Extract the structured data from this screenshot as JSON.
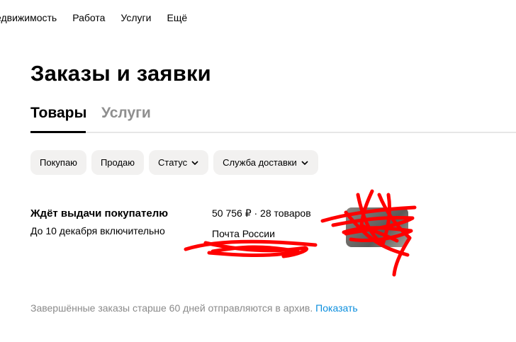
{
  "topnav": {
    "items": [
      "едвижимость",
      "Работа",
      "Услуги",
      "Ещё"
    ]
  },
  "page": {
    "title": "Заказы и заявки"
  },
  "tabs": [
    {
      "label": "Товары",
      "active": true
    },
    {
      "label": "Услуги",
      "active": false
    }
  ],
  "filters": {
    "buying": "Покупаю",
    "selling": "Продаю",
    "status": "Статус",
    "delivery": "Служба доставки"
  },
  "order": {
    "status": "Ждёт выдачи покупателю",
    "due": "До 10 декабря включительно",
    "summary": "50 756 ₽ · 28 товаров",
    "carrier": "Почта России"
  },
  "footer": {
    "note": "Завершённые заказы старше 60 дней отправляются в архив.",
    "link": "Показать"
  },
  "colors": {
    "accent": "#0a8ede",
    "chip": "#f2f1f0",
    "scribble": "#ff0000",
    "muted": "#8a8a8a"
  }
}
